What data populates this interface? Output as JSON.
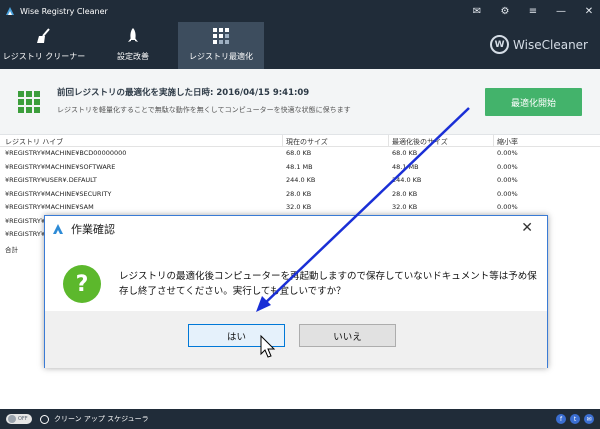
{
  "window": {
    "title": "Wise Registry Cleaner",
    "controls": [
      "minimize-icon",
      "settings-icon",
      "menu-icon",
      "minimize-window-icon",
      "maximize-icon",
      "close-icon"
    ]
  },
  "nav": {
    "tabs": [
      {
        "label": "レジストリ クリーナー",
        "icon": "broom-icon"
      },
      {
        "label": "設定改善",
        "icon": "rocket-icon"
      },
      {
        "label": "レジストリ最適化",
        "icon": "grid-icon",
        "active": true
      }
    ],
    "brand": "WiseCleaner",
    "brand_logo": "W"
  },
  "banner": {
    "title": "前回レジストリの最適化を実施した日時: 2016/04/15 9:41:09",
    "description": "レジストリを軽量化することで無駄な動作を無くしてコンピューターを快適な状態に保ちます",
    "button": "最適化開始",
    "accent": "#43b36b"
  },
  "table": {
    "headers": [
      "レジストリ ハイブ",
      "現在のサイズ",
      "最適化後のサイズ",
      "縮小率"
    ],
    "rows": [
      [
        "¥REGISTRY¥MACHINE¥BCD00000000",
        "68.0 KB",
        "68.0 KB",
        "0.00%"
      ],
      [
        "¥REGISTRY¥MACHINE¥SOFTWARE",
        "48.1 MB",
        "48.1 MB",
        "0.00%"
      ],
      [
        "¥REGISTRY¥USER¥.DEFAULT",
        "244.0 KB",
        "244.0 KB",
        "0.00%"
      ],
      [
        "¥REGISTRY¥MACHINE¥SECURITY",
        "28.0 KB",
        "28.0 KB",
        "0.00%"
      ],
      [
        "¥REGISTRY¥MACHINE¥SAM",
        "32.0 KB",
        "32.0 KB",
        "0.00%"
      ],
      [
        "¥REGISTRY¥",
        "",
        "",
        ""
      ],
      [
        "¥REGISTRY¥",
        "",
        "",
        ""
      ],
      [
        "合計",
        "",
        "",
        ""
      ]
    ]
  },
  "footer": {
    "toggle": "OFF",
    "scheduler": "クリーン アップ スケジューラ",
    "social": [
      "f",
      "t",
      "✉"
    ]
  },
  "dialog": {
    "title": "作業確認",
    "message": "レジストリの最適化後コンピューターを再起動しますので保存していないドキュメント等は予め保存し終了させてください。実行しても宜しいですか？",
    "yes": "はい",
    "no": "いいえ",
    "icon": "question-icon"
  },
  "annotation": {
    "arrow_color": "#1a2fd6"
  }
}
